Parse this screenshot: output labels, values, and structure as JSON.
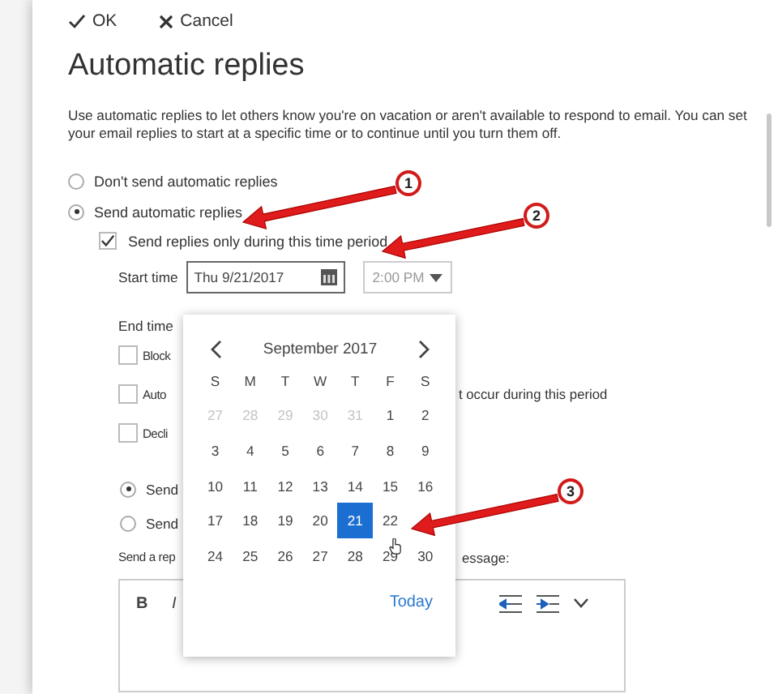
{
  "toolbar": [
    {
      "kind": "ok",
      "label": "OK"
    },
    {
      "kind": "cancel",
      "label": "Cancel"
    }
  ],
  "title": "Automatic replies",
  "description": "Use automatic replies to let others know you're on vacation or aren't available to respond to email. You can set your email replies to start at a specific time or to continue until you turn them off.",
  "reply_options": [
    {
      "label": "Don't send automatic replies",
      "selected": false
    },
    {
      "label": "Send automatic replies",
      "selected": true
    }
  ],
  "time_period": {
    "label": "Send replies only during this time period",
    "checked": true
  },
  "start_time": {
    "label": "Start time",
    "date": "Thu 9/21/2017",
    "time": "2:00 PM"
  },
  "end_time": {
    "label": "End time"
  },
  "options": [
    {
      "label": "Block",
      "checked": false
    },
    {
      "label": "Auto",
      "checked": false,
      "trailing": "t occur during this period"
    },
    {
      "label": "Decli",
      "checked": false
    }
  ],
  "audience": [
    {
      "label": "Send",
      "selected": true
    },
    {
      "label": "Send",
      "selected": false
    }
  ],
  "message_label": {
    "left": "Send a rep",
    "right": "essage:"
  },
  "editor_toolbar": [
    {
      "kind": "bold",
      "label": "B"
    },
    {
      "kind": "italic",
      "label": "I"
    },
    {
      "kind": "outdent"
    },
    {
      "kind": "indent"
    },
    {
      "kind": "more"
    }
  ],
  "calendar": {
    "month": "September 2017",
    "weekdays": [
      "S",
      "M",
      "T",
      "W",
      "T",
      "F",
      "S"
    ],
    "today_label": "Today",
    "weeks": [
      [
        {
          "day": "27",
          "outside": true,
          "selected": false
        },
        {
          "day": "28",
          "outside": true,
          "selected": false
        },
        {
          "day": "29",
          "outside": true,
          "selected": false
        },
        {
          "day": "30",
          "outside": true,
          "selected": false
        },
        {
          "day": "31",
          "outside": true,
          "selected": false
        },
        {
          "day": "1",
          "outside": false,
          "selected": false
        },
        {
          "day": "2",
          "outside": false,
          "selected": false
        }
      ],
      [
        {
          "day": "3",
          "outside": false,
          "selected": false
        },
        {
          "day": "4",
          "outside": false,
          "selected": false
        },
        {
          "day": "5",
          "outside": false,
          "selected": false
        },
        {
          "day": "6",
          "outside": false,
          "selected": false
        },
        {
          "day": "7",
          "outside": false,
          "selected": false
        },
        {
          "day": "8",
          "outside": false,
          "selected": false
        },
        {
          "day": "9",
          "outside": false,
          "selected": false
        }
      ],
      [
        {
          "day": "10",
          "outside": false,
          "selected": false
        },
        {
          "day": "11",
          "outside": false,
          "selected": false
        },
        {
          "day": "12",
          "outside": false,
          "selected": false
        },
        {
          "day": "13",
          "outside": false,
          "selected": false
        },
        {
          "day": "14",
          "outside": false,
          "selected": false
        },
        {
          "day": "15",
          "outside": false,
          "selected": false
        },
        {
          "day": "16",
          "outside": false,
          "selected": false
        }
      ],
      [
        {
          "day": "17",
          "outside": false,
          "selected": false
        },
        {
          "day": "18",
          "outside": false,
          "selected": false
        },
        {
          "day": "19",
          "outside": false,
          "selected": false
        },
        {
          "day": "20",
          "outside": false,
          "selected": false
        },
        {
          "day": "21",
          "outside": false,
          "selected": true
        },
        {
          "day": "22",
          "outside": false,
          "selected": false
        }
      ],
      [
        {
          "day": "24",
          "outside": false,
          "selected": false
        },
        {
          "day": "25",
          "outside": false,
          "selected": false
        },
        {
          "day": "26",
          "outside": false,
          "selected": false
        },
        {
          "day": "27",
          "outside": false,
          "selected": false
        },
        {
          "day": "28",
          "outside": false,
          "selected": false
        },
        {
          "day": "29",
          "outside": false,
          "selected": false
        },
        {
          "day": "30",
          "outside": false,
          "selected": false
        }
      ]
    ]
  },
  "annotations": [
    {
      "number": "1"
    },
    {
      "number": "2"
    },
    {
      "number": "3"
    }
  ]
}
